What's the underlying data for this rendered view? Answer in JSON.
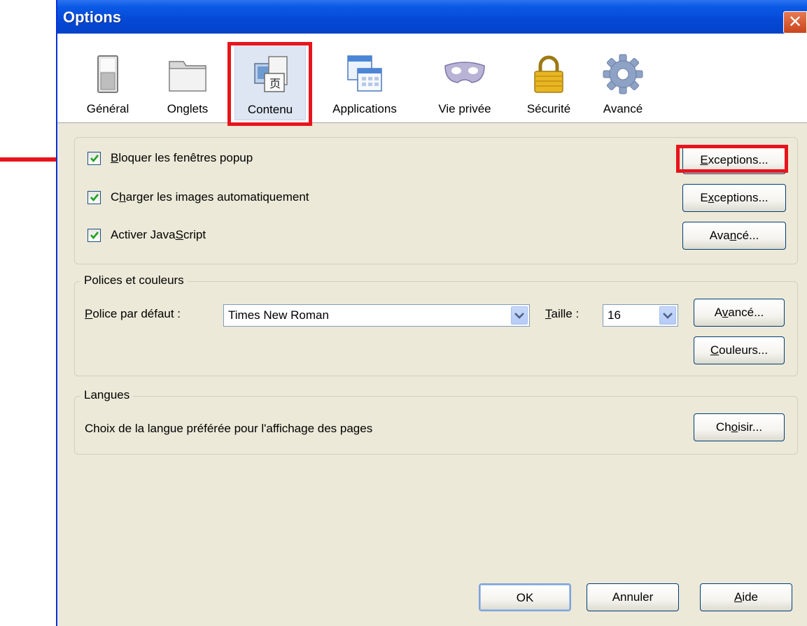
{
  "window": {
    "title": "Options",
    "close_glyph": "✕"
  },
  "tabs": [
    {
      "label": "Général",
      "icon": "switch-icon"
    },
    {
      "label": "Onglets",
      "icon": "folder-tabs-icon"
    },
    {
      "label": "Contenu",
      "icon": "content-icon"
    },
    {
      "label": "Applications",
      "icon": "applications-icon"
    },
    {
      "label": "Vie privée",
      "icon": "mask-icon"
    },
    {
      "label": "Sécurité",
      "icon": "padlock-icon"
    },
    {
      "label": "Avancé",
      "icon": "gear-icon"
    }
  ],
  "selected_tab": "Contenu",
  "content": {
    "popup": {
      "pre": "",
      "ul": "B",
      "post": "loquer les fenêtres popup",
      "checked": true
    },
    "images": {
      "pre": "C",
      "ul": "h",
      "post": "arger les images automatiquement",
      "checked": true
    },
    "javascript": {
      "pre": "Activer Java",
      "ul": "S",
      "post": "cript",
      "checked": true
    },
    "btn_exceptions1": {
      "pre": "",
      "ul": "E",
      "post": "xceptions..."
    },
    "btn_exceptions2": {
      "pre": "E",
      "ul": "x",
      "post": "ceptions..."
    },
    "btn_advanced_js": {
      "pre": "Ava",
      "ul": "n",
      "post": "cé..."
    }
  },
  "fonts": {
    "legend": "Polices et couleurs",
    "default_label": {
      "pre": "",
      "ul": "P",
      "post": "olice par défaut :"
    },
    "font_value": "Times New Roman",
    "size_label": {
      "pre": "",
      "ul": "T",
      "post": "aille :"
    },
    "size_value": "16",
    "btn_advanced": {
      "pre": "A",
      "ul": "v",
      "post": "ancé..."
    },
    "btn_colors": {
      "pre": "",
      "ul": "C",
      "post": "ouleurs..."
    }
  },
  "languages": {
    "legend": "Langues",
    "description": "Choix de la langue préférée pour l'affichage des pages",
    "btn_choose": {
      "pre": "Ch",
      "ul": "o",
      "post": "isir..."
    }
  },
  "footer": {
    "ok": "OK",
    "cancel": "Annuler",
    "help": {
      "pre": "",
      "ul": "A",
      "post": "ide"
    }
  },
  "colors": {
    "annotation": "#e8141c",
    "titlebar": "#0a5ae6",
    "check": "#21a121"
  }
}
